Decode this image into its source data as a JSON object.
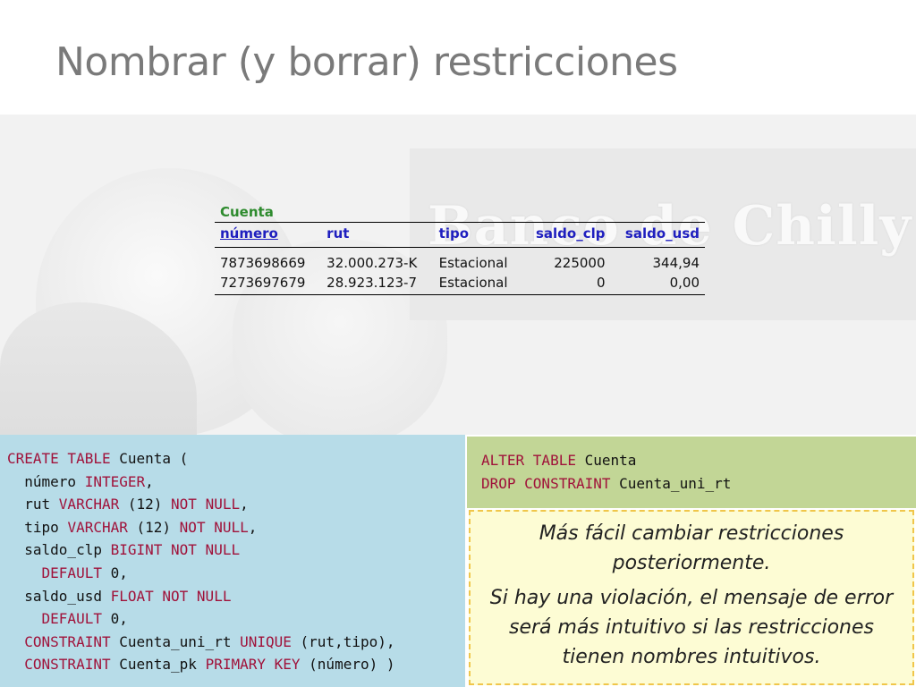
{
  "slide": {
    "title": "Nombrar (y borrar) restricciones",
    "banner_text": "Banco de Chilly"
  },
  "table": {
    "name": "Cuenta",
    "headers": [
      "número",
      "rut",
      "tipo",
      "saldo_clp",
      "saldo_usd"
    ],
    "rows": [
      [
        "7873698669",
        "32.000.273-K",
        "Estacional",
        "225000",
        "344,94"
      ],
      [
        "7273697679",
        "28.923.123-7",
        "Estacional",
        "0",
        "0,00"
      ]
    ]
  },
  "code_left": {
    "lines": [
      [
        [
          "kw",
          "CREATE TABLE"
        ],
        [
          "t",
          " Cuenta ("
        ]
      ],
      [
        [
          "t",
          "  número "
        ],
        [
          "kw",
          "INTEGER"
        ],
        [
          "t",
          ","
        ]
      ],
      [
        [
          "t",
          "  rut "
        ],
        [
          "kw",
          "VARCHAR"
        ],
        [
          "t",
          " (12) "
        ],
        [
          "kw",
          "NOT NULL"
        ],
        [
          "t",
          ","
        ]
      ],
      [
        [
          "t",
          "  tipo "
        ],
        [
          "kw",
          "VARCHAR"
        ],
        [
          "t",
          " (12) "
        ],
        [
          "kw",
          "NOT NULL"
        ],
        [
          "t",
          ","
        ]
      ],
      [
        [
          "t",
          "  saldo_clp "
        ],
        [
          "kw",
          "BIGINT NOT NULL"
        ]
      ],
      [
        [
          "t",
          "    "
        ],
        [
          "kw",
          "DEFAULT"
        ],
        [
          "t",
          " 0,"
        ]
      ],
      [
        [
          "t",
          "  saldo_usd "
        ],
        [
          "kw",
          "FLOAT NOT NULL"
        ]
      ],
      [
        [
          "t",
          "    "
        ],
        [
          "kw",
          "DEFAULT"
        ],
        [
          "t",
          " 0,"
        ]
      ],
      [
        [
          "t",
          "  "
        ],
        [
          "kw",
          "CONSTRAINT"
        ],
        [
          "t",
          " Cuenta_uni_rt "
        ],
        [
          "kw",
          "UNIQUE"
        ],
        [
          "t",
          " (rut,tipo),"
        ]
      ],
      [
        [
          "t",
          "  "
        ],
        [
          "kw",
          "CONSTRAINT"
        ],
        [
          "t",
          " Cuenta_pk "
        ],
        [
          "kw",
          "PRIMARY KEY"
        ],
        [
          "t",
          " (número) )"
        ]
      ]
    ]
  },
  "code_right": {
    "lines": [
      [
        [
          "kw",
          "ALTER TABLE"
        ],
        [
          "t",
          " Cuenta"
        ]
      ],
      [
        [
          "kw",
          "DROP CONSTRAINT"
        ],
        [
          "t",
          " Cuenta_uni_rt"
        ]
      ]
    ]
  },
  "note": {
    "p1": "Más fácil cambiar restricciones posteriormente.",
    "p2": "Si hay una violación, el mensaje de error será más intuitivo si las restricciones tienen nombres intuitivos."
  }
}
